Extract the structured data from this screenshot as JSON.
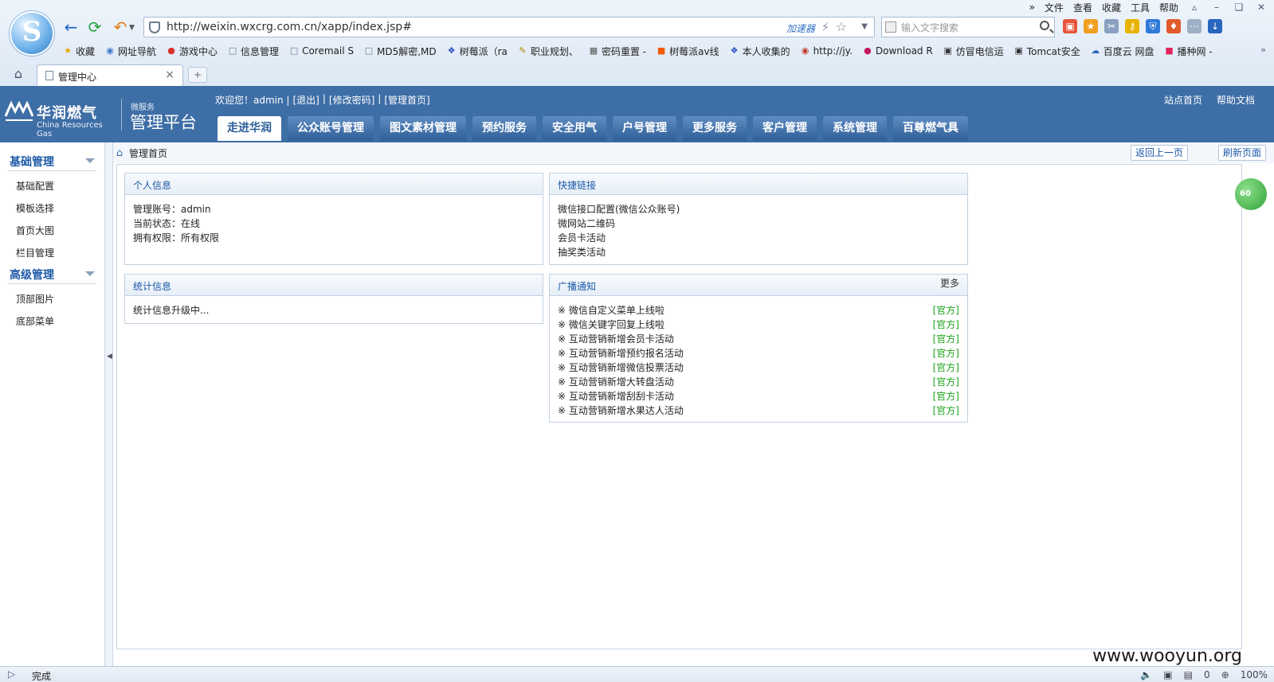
{
  "browser": {
    "menu": [
      "文件",
      "查看",
      "收藏",
      "工具",
      "帮助"
    ],
    "menu_more": "»",
    "url": "http://weixin.wxcrg.com.cn/xapp/index.jsp#",
    "accelerator_label": "加速器",
    "search_placeholder": "输入文字搜索",
    "bookmarks": [
      {
        "label": "收藏",
        "icon": "star-icon"
      },
      {
        "label": "网址导航",
        "icon": "globe-icon"
      },
      {
        "label": "游戏中心",
        "icon": "game-icon"
      },
      {
        "label": "信息管理",
        "icon": "page-icon"
      },
      {
        "label": "Coremail S",
        "icon": "page-icon"
      },
      {
        "label": "MD5解密,MD",
        "icon": "page-icon"
      },
      {
        "label": "树莓派（ra",
        "icon": "paw-icon"
      },
      {
        "label": "职业规划、",
        "icon": "pencil-icon"
      },
      {
        "label": "密码重置 -",
        "icon": "image-icon"
      },
      {
        "label": "树莓派av线",
        "icon": "taobao-icon"
      },
      {
        "label": "本人收集的",
        "icon": "paw-icon"
      },
      {
        "label": "http://jy.",
        "icon": "weibo-icon"
      },
      {
        "label": "Download R",
        "icon": "raspberry-icon"
      },
      {
        "label": "仿冒电信运",
        "icon": "terminal-icon"
      },
      {
        "label": "Tomcat安全",
        "icon": "terminal-icon"
      },
      {
        "label": "百度云 网盘",
        "icon": "cloud-icon"
      },
      {
        "label": "播种网 -",
        "icon": "bo-icon"
      }
    ],
    "bookmarks_more": "»",
    "tab_title": "管理中心",
    "status_text": "完成",
    "status_count": "0",
    "zoom": "100%"
  },
  "header": {
    "brand_cn": "华润燃气",
    "brand_en": "China Resources Gas",
    "platform_small": "微服务",
    "platform": "管理平台",
    "welcome_prefix": "欢迎您！admin |",
    "logout": "[退出]",
    "sep1": "|",
    "change_password": "[修改密码]",
    "sep2": "|",
    "admin_home": "[管理首页]",
    "site_home": "站点首页",
    "help_docs": "帮助文档",
    "nav": [
      "走进华润",
      "公众账号管理",
      "图文素材管理",
      "预约服务",
      "安全用气",
      "户号管理",
      "更多服务",
      "客户管理",
      "系统管理",
      "百尊燃气具"
    ],
    "active_nav": "走进华润"
  },
  "sidebar": {
    "groups": [
      {
        "title": "基础管理",
        "items": [
          "基础配置",
          "模板选择",
          "首页大图",
          "栏目管理"
        ]
      },
      {
        "title": "高级管理",
        "items": [
          "顶部图片",
          "底部菜单"
        ]
      }
    ]
  },
  "breadcrumb": {
    "current": "管理首页",
    "back_button": "返回上一页",
    "refresh_button": "刷新页面"
  },
  "panels": {
    "personal": {
      "title": "个人信息",
      "account": "管理账号：admin",
      "status": "当前状态：在线",
      "permission": "拥有权限：所有权限"
    },
    "quicklinks": {
      "title": "快捷链接",
      "items": [
        "微信接口配置(微信公众账号)",
        "微网站二维码",
        "会员卡活动",
        "抽奖类活动"
      ]
    },
    "stats": {
      "title": "统计信息",
      "text": "统计信息升级中..."
    },
    "broadcast": {
      "title": "广播通知",
      "more": "更多",
      "items": [
        {
          "text": "※ 微信自定义菜单上线啦",
          "tag": "[官方]"
        },
        {
          "text": "※ 微信关键字回复上线啦",
          "tag": "[官方]"
        },
        {
          "text": "※ 互动营销新增会员卡活动",
          "tag": "[官方]"
        },
        {
          "text": "※ 互动营销新增预约报名活动",
          "tag": "[官方]"
        },
        {
          "text": "※ 互动营销新增微信投票活动",
          "tag": "[官方]"
        },
        {
          "text": "※ 互动营销新增大转盘活动",
          "tag": "[官方]"
        },
        {
          "text": "※ 互动营销新增刮刮卡活动",
          "tag": "[官方]"
        },
        {
          "text": "※ 互动营销新增水果达人活动",
          "tag": "[官方]"
        }
      ]
    }
  },
  "float_badge": "60",
  "watermark": "www.wooyun.org",
  "colors": {
    "header_bg": "#3e6ea6",
    "link_blue": "#1e5aa8",
    "tag_green": "#1aa31a"
  }
}
